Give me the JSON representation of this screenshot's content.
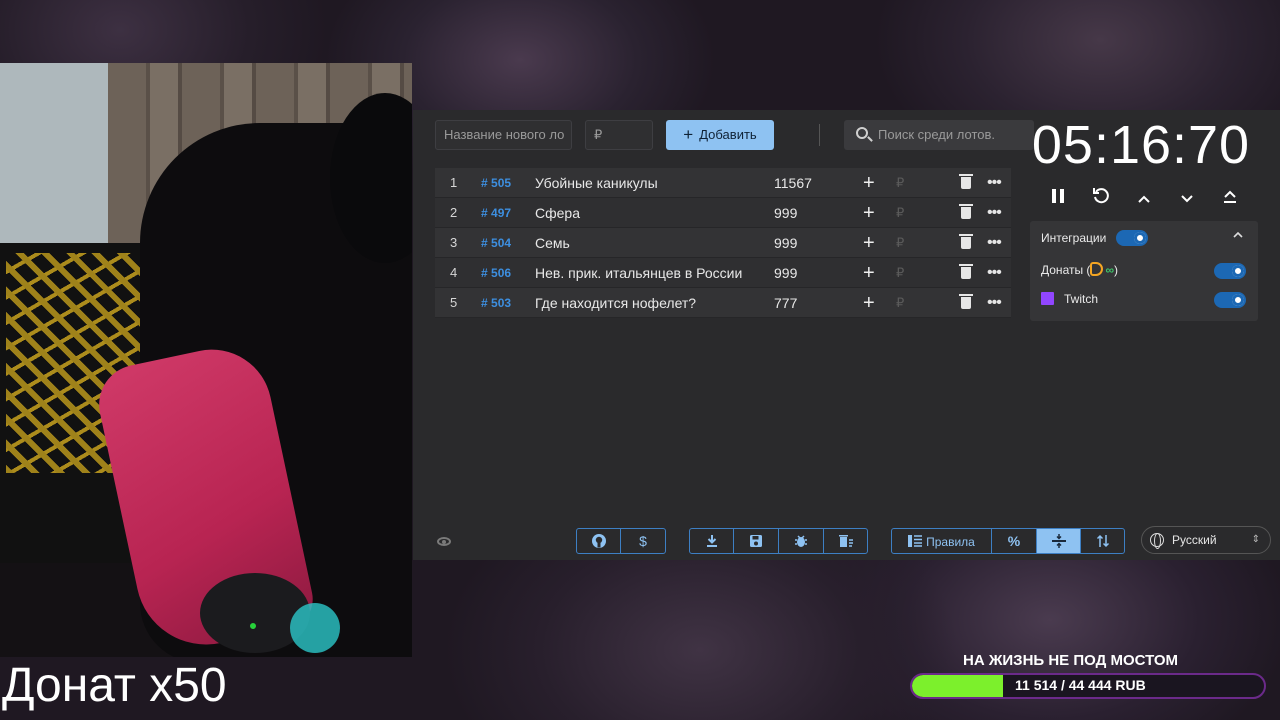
{
  "overlay": {
    "donate_text": "Донат x50",
    "goal_title": "НА ЖИЗНЬ НЕ ПОД МОСТОМ",
    "goal_amount": "11 514 / 44 444 RUB",
    "goal_fraction": 0.259
  },
  "toolbar": {
    "name_placeholder": "Название нового ло",
    "price_placeholder": "₽",
    "add_label": "Добавить",
    "search_placeholder": "Поиск среди лотов."
  },
  "lots": [
    {
      "index": "1",
      "id": "505",
      "name": "Убойные каникулы",
      "amount": "11567"
    },
    {
      "index": "2",
      "id": "497",
      "name": "Сфера",
      "amount": "999"
    },
    {
      "index": "3",
      "id": "504",
      "name": "Семь",
      "amount": "999"
    },
    {
      "index": "4",
      "id": "506",
      "name": "Нев. прик. итальянцев в России",
      "amount": "999"
    },
    {
      "index": "5",
      "id": "503",
      "name": "Где находится нофелет?",
      "amount": "777"
    }
  ],
  "lot_symbols": {
    "hash": "#",
    "plus": "+",
    "rub": "₽",
    "more": "•••"
  },
  "footer": {
    "rules_label": "Правила",
    "percent_label": "%",
    "dollar_label": "$",
    "language": "Русский"
  },
  "timer": {
    "display": "05:16:70"
  },
  "integrations": {
    "title": "Интеграции",
    "donations_label": "Донаты (",
    "donations_close": ")",
    "infinity": "∞",
    "twitch_label": "Twitch"
  },
  "colors": {
    "accent": "#8ec2f2",
    "toggle": "#1c68b4",
    "goal_fill": "#7cf02c",
    "lot_id": "#3d8fe0"
  }
}
